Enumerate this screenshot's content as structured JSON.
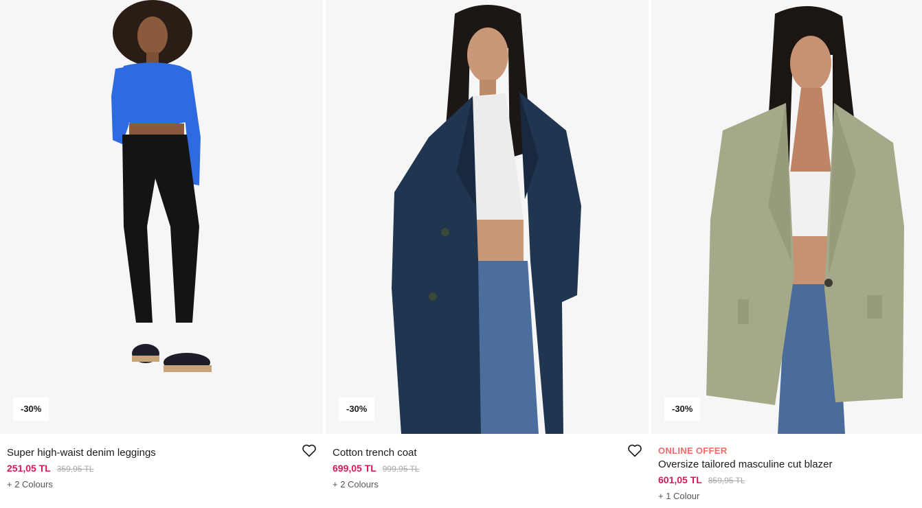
{
  "products": [
    {
      "badge": "-30%",
      "offer": "",
      "name": "Super high-waist denim leggings",
      "price_now": "251,05 TL",
      "price_old": "359,95 TL",
      "colours": "+ 2 Colours",
      "photo_icon": "product-photo-leggings"
    },
    {
      "badge": "-30%",
      "offer": "",
      "name": "Cotton trench coat",
      "price_now": "699,05 TL",
      "price_old": "999,95 TL",
      "colours": "+ 2 Colours",
      "photo_icon": "product-photo-trench-coat"
    },
    {
      "badge": "-30%",
      "offer": "ONLINE OFFER",
      "name": "Oversize tailored masculine cut blazer",
      "price_now": "601,05 TL",
      "price_old": "859,95 TL",
      "colours": "+ 1 Colour",
      "photo_icon": "product-photo-blazer"
    }
  ],
  "colors": {
    "sale_price": "#d8175a",
    "offer_label": "#f06a6a",
    "old_price": "#a8a8a8",
    "photo_bg": "#f6f6f6"
  }
}
